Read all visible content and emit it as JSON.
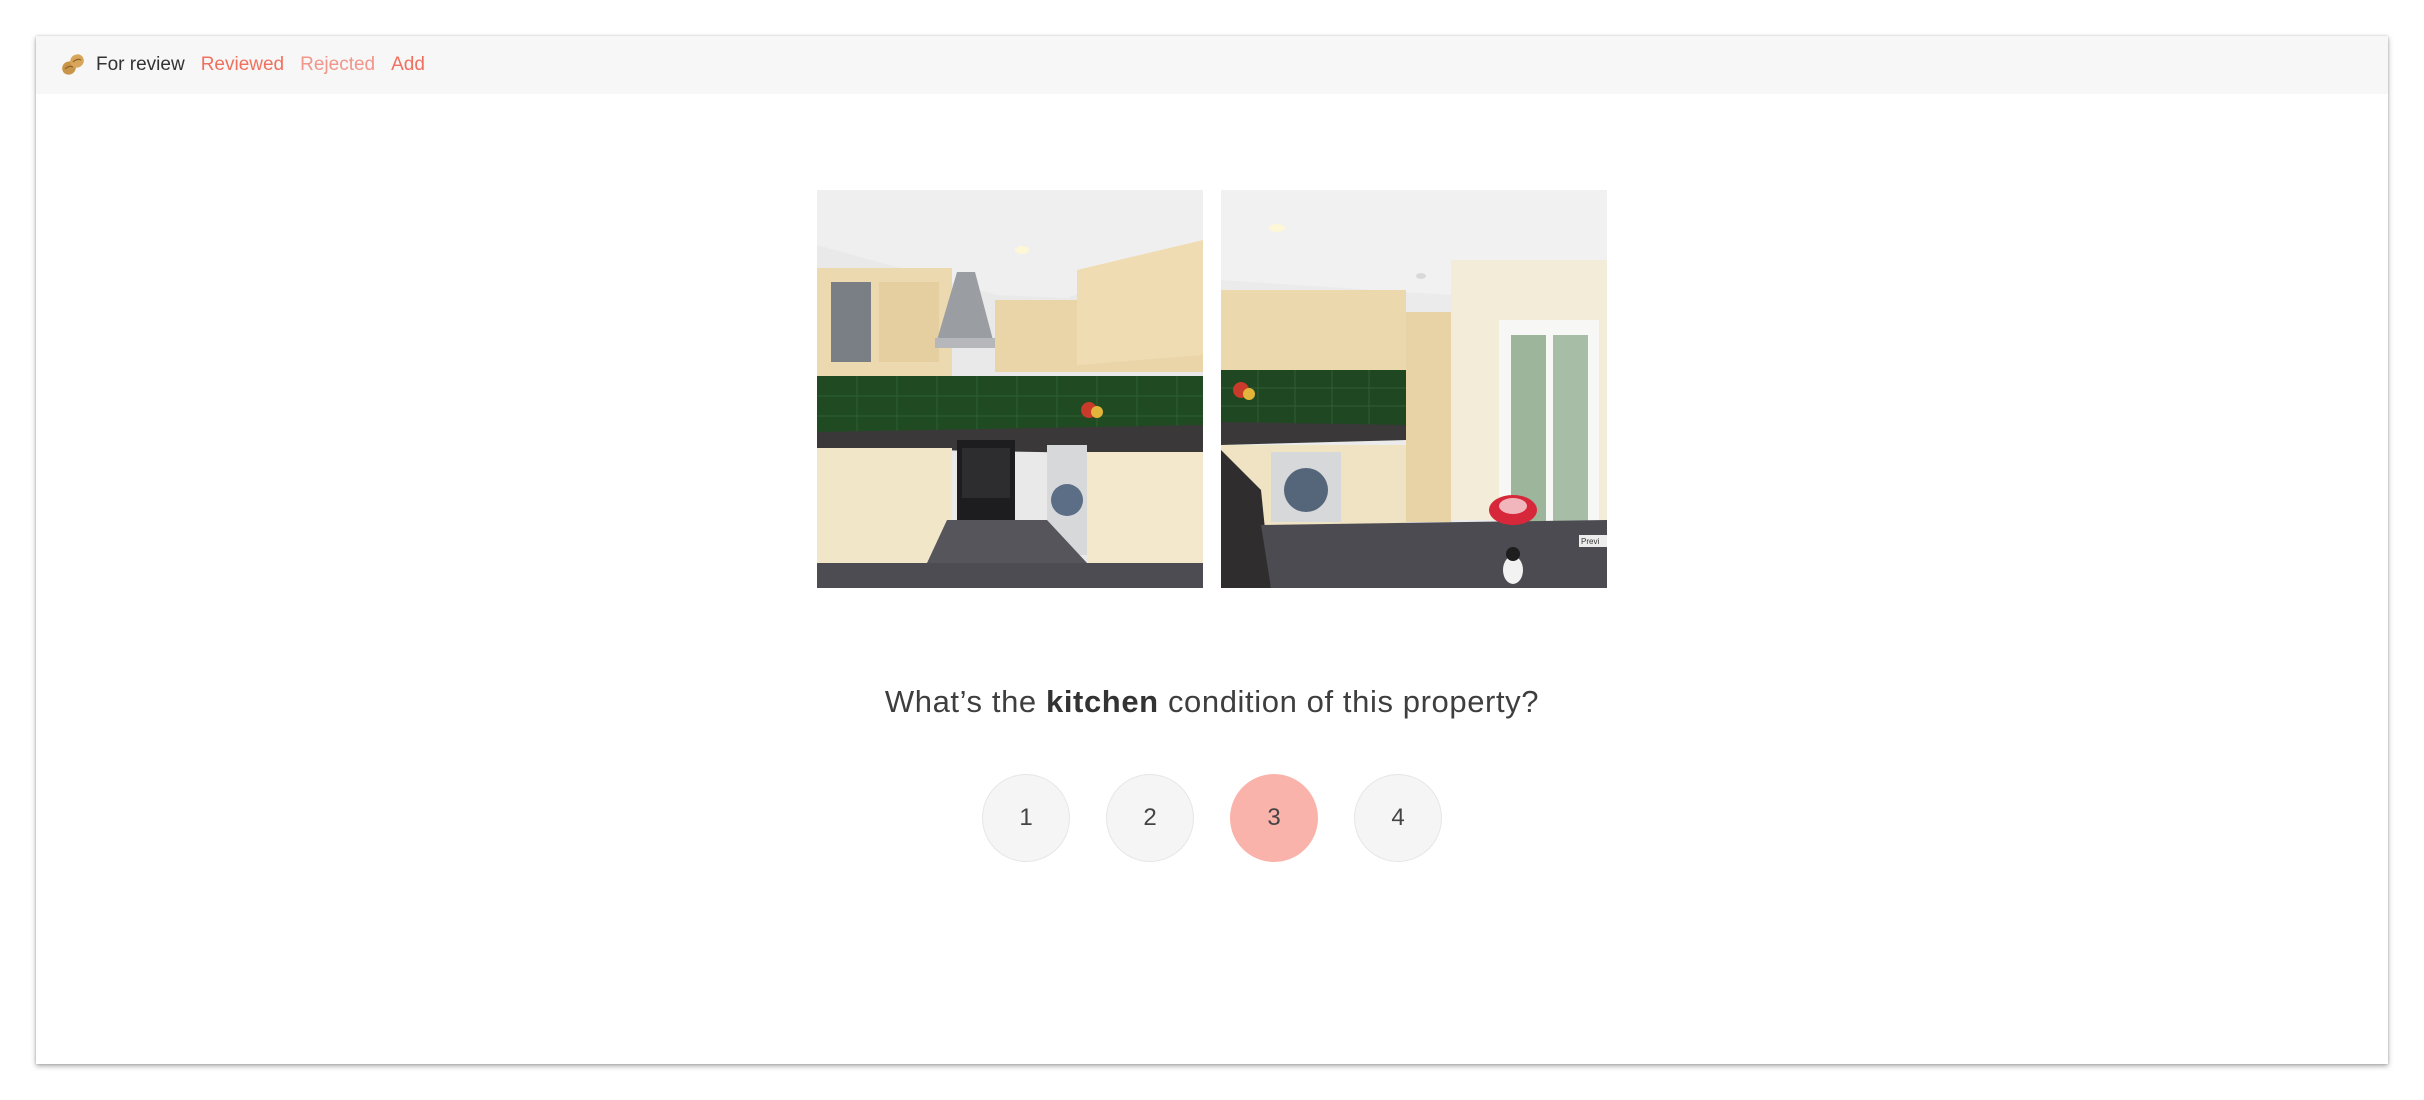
{
  "nav": {
    "logo_icon": "peanut-icon",
    "items": [
      {
        "label": "For review",
        "state": "current"
      },
      {
        "label": "Reviewed",
        "state": "link"
      },
      {
        "label": "Rejected",
        "state": "link-faded"
      },
      {
        "label": "Add",
        "state": "link"
      }
    ]
  },
  "photos": [
    {
      "alt": "Kitchen with cream cabinets, green tiled backsplash, cooker hood, oven and washing machine"
    },
    {
      "alt": "Kitchen with cream cabinets, washing machine, french doors to garden and red pet bed",
      "watermark": "Previ"
    }
  ],
  "question": {
    "prefix": "What’s the",
    "emphasis": "kitchen",
    "suffix": "condition of this property?"
  },
  "ratings": [
    {
      "label": "1",
      "selected": false
    },
    {
      "label": "2",
      "selected": false
    },
    {
      "label": "3",
      "selected": true
    },
    {
      "label": "4",
      "selected": false
    }
  ],
  "colors": {
    "accent": "#f0705f",
    "selected_rating": "#fab3aa",
    "topbar_bg": "#f7f7f7"
  }
}
